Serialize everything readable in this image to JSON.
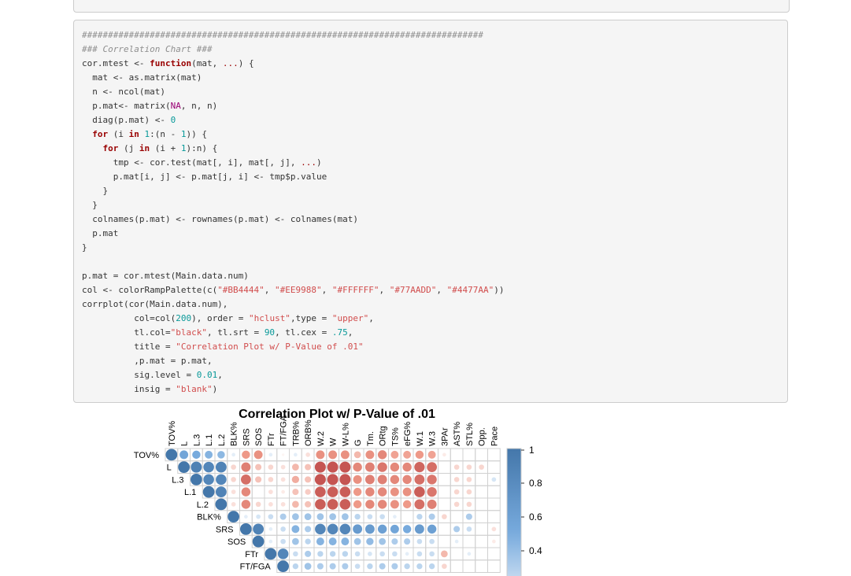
{
  "code": {
    "lines": [
      [
        {
          "t": "#############################################################################",
          "c": "cm"
        }
      ],
      [
        {
          "t": "### Correlation Chart ###",
          "c": "cm"
        }
      ],
      [
        {
          "t": "cor.mtest <- ",
          "c": ""
        },
        {
          "t": "function",
          "c": "kw"
        },
        {
          "t": "(mat, ",
          "c": ""
        },
        {
          "t": "...",
          "c": "kw2"
        },
        {
          "t": ") {",
          "c": ""
        }
      ],
      [
        {
          "t": "  mat <- as.matrix(mat)",
          "c": ""
        }
      ],
      [
        {
          "t": "  n <- ncol(mat)",
          "c": ""
        }
      ],
      [
        {
          "t": "  p.mat<- matrix(",
          "c": ""
        },
        {
          "t": "NA",
          "c": "na"
        },
        {
          "t": ", n, n)",
          "c": ""
        }
      ],
      [
        {
          "t": "  diag(p.mat) <- ",
          "c": ""
        },
        {
          "t": "0",
          "c": "num"
        }
      ],
      [
        {
          "t": "  ",
          "c": ""
        },
        {
          "t": "for",
          "c": "kw"
        },
        {
          "t": " (i ",
          "c": ""
        },
        {
          "t": "in",
          "c": "kw"
        },
        {
          "t": " ",
          "c": ""
        },
        {
          "t": "1",
          "c": "num"
        },
        {
          "t": ":(n - ",
          "c": ""
        },
        {
          "t": "1",
          "c": "num"
        },
        {
          "t": ")) {",
          "c": ""
        }
      ],
      [
        {
          "t": "    ",
          "c": ""
        },
        {
          "t": "for",
          "c": "kw"
        },
        {
          "t": " (j ",
          "c": ""
        },
        {
          "t": "in",
          "c": "kw"
        },
        {
          "t": " (i + ",
          "c": ""
        },
        {
          "t": "1",
          "c": "num"
        },
        {
          "t": "):n) {",
          "c": ""
        }
      ],
      [
        {
          "t": "      tmp <- cor.test(mat[, i], mat[, j], ",
          "c": ""
        },
        {
          "t": "...",
          "c": "kw2"
        },
        {
          "t": ")",
          "c": ""
        }
      ],
      [
        {
          "t": "      p.mat[i, j] <- p.mat[j, i] <- tmp$p.value",
          "c": ""
        }
      ],
      [
        {
          "t": "    }",
          "c": ""
        }
      ],
      [
        {
          "t": "  }",
          "c": ""
        }
      ],
      [
        {
          "t": "  colnames(p.mat) <- rownames(p.mat) <- colnames(mat)",
          "c": ""
        }
      ],
      [
        {
          "t": "  p.mat",
          "c": ""
        }
      ],
      [
        {
          "t": "}",
          "c": ""
        }
      ],
      [
        {
          "t": "",
          "c": ""
        }
      ],
      [
        {
          "t": "p.mat = cor.mtest(Main.data.num)",
          "c": ""
        }
      ],
      [
        {
          "t": "col <- colorRampPalette(c(",
          "c": ""
        },
        {
          "t": "\"#BB4444\"",
          "c": "str"
        },
        {
          "t": ", ",
          "c": ""
        },
        {
          "t": "\"#EE9988\"",
          "c": "str"
        },
        {
          "t": ", ",
          "c": ""
        },
        {
          "t": "\"#FFFFFF\"",
          "c": "str"
        },
        {
          "t": ", ",
          "c": ""
        },
        {
          "t": "\"#77AADD\"",
          "c": "str"
        },
        {
          "t": ", ",
          "c": ""
        },
        {
          "t": "\"#4477AA\"",
          "c": "str"
        },
        {
          "t": "))",
          "c": ""
        }
      ],
      [
        {
          "t": "corrplot(cor(Main.data.num),",
          "c": ""
        }
      ],
      [
        {
          "t": "          col=col(",
          "c": ""
        },
        {
          "t": "200",
          "c": "num"
        },
        {
          "t": "), order = ",
          "c": ""
        },
        {
          "t": "\"hclust\"",
          "c": "str"
        },
        {
          "t": ",type = ",
          "c": ""
        },
        {
          "t": "\"upper\"",
          "c": "str"
        },
        {
          "t": ",",
          "c": ""
        }
      ],
      [
        {
          "t": "          tl.col=",
          "c": ""
        },
        {
          "t": "\"black\"",
          "c": "str"
        },
        {
          "t": ", tl.srt = ",
          "c": ""
        },
        {
          "t": "90",
          "c": "num"
        },
        {
          "t": ", tl.cex = ",
          "c": ""
        },
        {
          "t": ".75",
          "c": "num"
        },
        {
          "t": ",",
          "c": ""
        }
      ],
      [
        {
          "t": "          title = ",
          "c": ""
        },
        {
          "t": "\"Correlation Plot w/ P-Value of .01\"",
          "c": "str"
        }
      ],
      [
        {
          "t": "          ,p.mat = p.mat,",
          "c": ""
        }
      ],
      [
        {
          "t": "          sig.level = ",
          "c": ""
        },
        {
          "t": "0.01",
          "c": "num"
        },
        {
          "t": ",",
          "c": ""
        }
      ],
      [
        {
          "t": "          insig = ",
          "c": ""
        },
        {
          "t": "\"blank\"",
          "c": "str"
        },
        {
          "t": ")",
          "c": ""
        }
      ]
    ]
  },
  "chart_data": {
    "type": "heatmap",
    "title": "Correlation Plot w/ P-Value of .01",
    "columns": [
      "TOV%",
      "L",
      "L.3",
      "L.1",
      "L.2",
      "BLK%",
      "SRS",
      "SOS",
      "FTr",
      "FT/FGA",
      "TRB%",
      "ORB%",
      "W.2",
      "W",
      "W-L%",
      "G",
      "Tm.",
      "ORtg",
      "TS%",
      "eFG%",
      "W.1",
      "W.3",
      "3PAr",
      "AST%",
      "STL%",
      "Opp.",
      "Pace"
    ],
    "rows": [
      "TOV%",
      "L",
      "L.3",
      "L.1",
      "L.2",
      "BLK%",
      "SRS",
      "SOS",
      "FTr",
      "FT/FGA"
    ],
    "colorbar": {
      "ticks": [
        "1",
        "0.8",
        "0.6",
        "0.4"
      ],
      "colors": [
        "#BB4444",
        "#EE9988",
        "#FFFFFF",
        "#77AADD",
        "#4477AA"
      ]
    },
    "matrix": [
      [
        1.0,
        0.55,
        0.5,
        0.45,
        0.42,
        0.1,
        -0.5,
        -0.55,
        0.1,
        -0.05,
        0.1,
        -0.15,
        -0.55,
        -0.55,
        -0.55,
        -0.35,
        -0.55,
        -0.6,
        -0.45,
        -0.45,
        -0.5,
        -0.45,
        -0.1,
        0,
        0,
        0,
        0
      ],
      [
        null,
        1.0,
        0.9,
        0.85,
        0.88,
        -0.2,
        -0.65,
        -0.3,
        -0.2,
        -0.15,
        -0.35,
        -0.3,
        -0.9,
        -0.9,
        -0.9,
        -0.6,
        -0.65,
        -0.7,
        -0.6,
        -0.6,
        -0.8,
        -0.75,
        0,
        -0.2,
        -0.2,
        -0.2,
        0
      ],
      [
        null,
        null,
        1.0,
        0.85,
        0.85,
        -0.2,
        -0.75,
        -0.3,
        -0.2,
        -0.15,
        -0.4,
        -0.3,
        -0.9,
        -0.9,
        -0.9,
        -0.55,
        -0.65,
        -0.65,
        -0.6,
        -0.6,
        -0.75,
        -0.7,
        0,
        -0.2,
        -0.2,
        0,
        0.15
      ],
      [
        null,
        null,
        null,
        1.0,
        0.88,
        -0.15,
        -0.6,
        0,
        -0.15,
        -0.1,
        -0.3,
        -0.25,
        -0.85,
        -0.85,
        -0.85,
        -0.5,
        -0.6,
        -0.6,
        -0.55,
        -0.55,
        -0.85,
        -0.7,
        0,
        -0.2,
        -0.2,
        0,
        0
      ],
      [
        null,
        null,
        null,
        null,
        1.0,
        -0.15,
        -0.6,
        -0.2,
        -0.15,
        -0.15,
        -0.35,
        -0.3,
        -0.85,
        -0.85,
        -0.85,
        -0.5,
        -0.6,
        -0.6,
        -0.55,
        -0.5,
        -0.75,
        -0.65,
        0,
        -0.2,
        -0.2,
        0,
        0
      ],
      [
        null,
        null,
        null,
        null,
        null,
        1.0,
        0.1,
        0.15,
        0.2,
        0.3,
        0.35,
        0.35,
        0.35,
        0.35,
        0.35,
        0.25,
        0.2,
        0.2,
        0.1,
        0,
        0.25,
        0.3,
        -0.2,
        0,
        0.3,
        0,
        0
      ],
      [
        null,
        null,
        null,
        null,
        null,
        null,
        1.0,
        0.88,
        0.1,
        0.2,
        0.45,
        0.3,
        0.85,
        0.85,
        0.85,
        0.65,
        0.65,
        0.6,
        0.55,
        0.5,
        0.65,
        0.6,
        0,
        0.3,
        0.2,
        0,
        -0.15
      ],
      [
        null,
        null,
        null,
        null,
        null,
        null,
        null,
        1.0,
        0.1,
        0.2,
        0.35,
        0.25,
        0.45,
        0.45,
        0.45,
        0.35,
        0.4,
        0.35,
        0.3,
        0.3,
        0.2,
        0.2,
        0,
        0.1,
        0,
        0,
        -0.1
      ],
      [
        null,
        null,
        null,
        null,
        null,
        null,
        null,
        null,
        1.0,
        0.85,
        0.2,
        0.3,
        0.25,
        0.25,
        0.25,
        0.2,
        0.15,
        0.2,
        0.2,
        0.1,
        0.2,
        0.2,
        -0.35,
        0,
        0.1,
        0,
        0
      ],
      [
        null,
        null,
        null,
        null,
        null,
        null,
        null,
        null,
        null,
        1.0,
        0.25,
        0.35,
        0.3,
        0.3,
        0.3,
        0.2,
        0.25,
        0.3,
        0.3,
        0.25,
        0.25,
        0.25,
        -0.2,
        0,
        0,
        0,
        0
      ]
    ]
  }
}
